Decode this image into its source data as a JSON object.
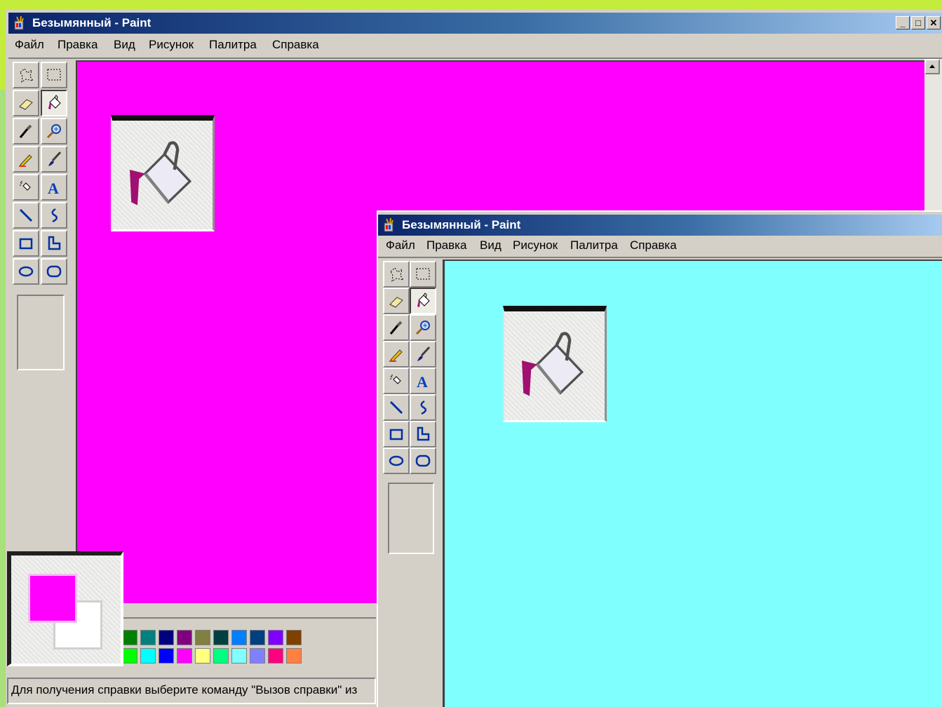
{
  "colors": {
    "magenta_canvas": "#ff00ff",
    "cyan_canvas": "#80ffff",
    "title_gradient_start": "#0a246a",
    "title_gradient_end": "#a6caf0",
    "slide_border": "#c4ec3c"
  },
  "window_back": {
    "title": "Безымянный - Paint",
    "controls": {
      "minimize": "_",
      "maximize": "□",
      "close": "✕"
    },
    "menu": [
      "Файл",
      "Правка",
      "Вид",
      "Рисунок",
      "Палитра",
      "Справка"
    ],
    "canvas_color": "#ff00ff",
    "status_text": "Для получения справки выберите команду \"Вызов справки\" из",
    "foreground_color": "#ff00ff",
    "background_color": "#ffffff",
    "palette": [
      "#008000",
      "#008080",
      "#000080",
      "#800080",
      "#808040",
      "#004040",
      "#0080ff",
      "#004080",
      "#8000ff",
      "#804000",
      "#00ff00",
      "#00ffff",
      "#0000ff",
      "#ff00ff",
      "#ffff80",
      "#00ff80",
      "#80ffff",
      "#8080ff",
      "#ff0080",
      "#ff8040"
    ]
  },
  "window_front": {
    "title": "Безымянный - Paint",
    "menu": [
      "Файл",
      "Правка",
      "Вид",
      "Рисунок",
      "Палитра",
      "Справка"
    ],
    "canvas_color": "#80ffff"
  },
  "tools": [
    "free-select-icon",
    "rect-select-icon",
    "eraser-icon",
    "fill-bucket-icon",
    "color-picker-icon",
    "magnifier-icon",
    "pencil-icon",
    "brush-icon",
    "airbrush-icon",
    "text-icon",
    "line-icon",
    "curve-icon",
    "rectangle-icon",
    "polygon-icon",
    "ellipse-icon",
    "rounded-rect-icon"
  ],
  "active_tool": "fill-bucket-icon"
}
